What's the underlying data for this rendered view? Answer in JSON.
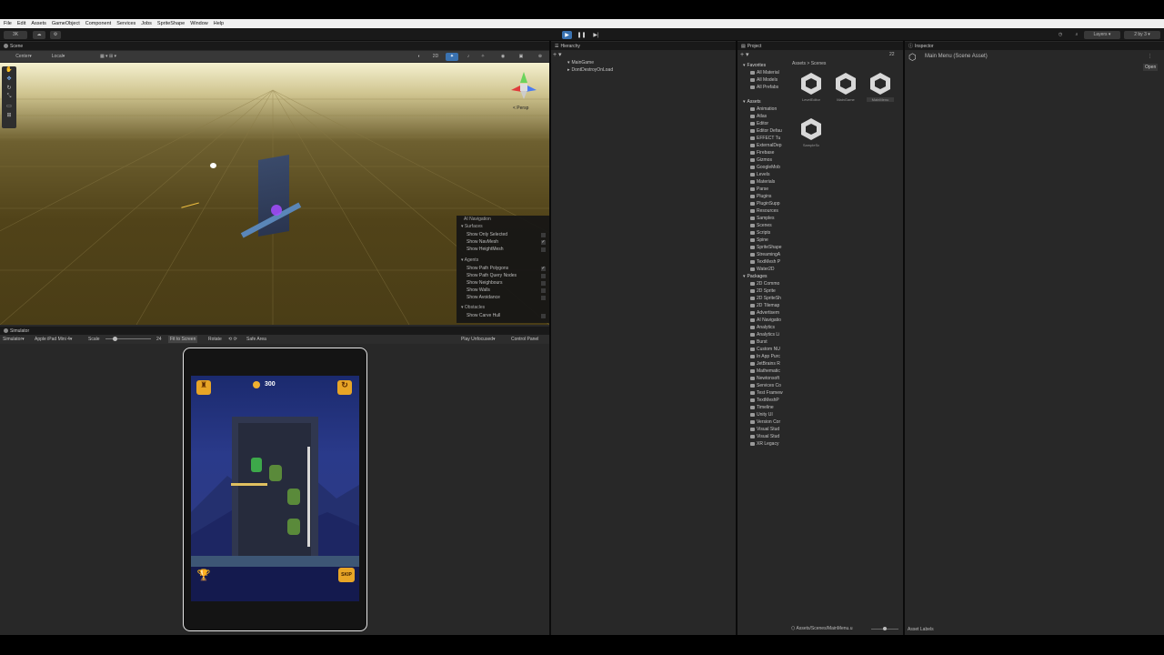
{
  "menu": [
    "File",
    "Edit",
    "Assets",
    "GameObject",
    "Component",
    "Services",
    "Jobs",
    "SpriteShape",
    "Window",
    "Help"
  ],
  "toolbar": {
    "left_label": "3K",
    "layers": "Layers",
    "layout": "2 by 3"
  },
  "scene": {
    "tab": "Scene",
    "pivot": "Center",
    "space": "Local",
    "mode_2d": "2D",
    "persp": "< Persp"
  },
  "ainav": {
    "title": "AI Navigation",
    "surfaces": "Surfaces",
    "surface_items": [
      {
        "label": "Show Only Selected",
        "checked": false
      },
      {
        "label": "Show NavMesh",
        "checked": true
      },
      {
        "label": "Show HeightMesh",
        "checked": false
      }
    ],
    "agents": "Agents",
    "agent_items": [
      {
        "label": "Show Path Polygons",
        "checked": true
      },
      {
        "label": "Show Path Query Nodes",
        "checked": false
      },
      {
        "label": "Show Neighbours",
        "checked": false
      },
      {
        "label": "Show Walls",
        "checked": false
      },
      {
        "label": "Show Avoidance",
        "checked": false
      }
    ],
    "obstacles": "Obstacles",
    "obstacle_items": [
      {
        "label": "Show Carve Hull",
        "checked": false
      }
    ]
  },
  "simulator": {
    "tab": "Simulator",
    "mode": "Simulator",
    "device": "Apple iPad Mini 4",
    "scale_label": "Scale",
    "scale_value": "24",
    "fit": "Fit to Screen",
    "rotate": "Rotate",
    "safe_area": "Safe Area",
    "play_mode": "Play Unfocused",
    "control_panel": "Control Panel"
  },
  "game": {
    "coins": "300",
    "skip": "SKIP"
  },
  "hierarchy": {
    "tab": "Hierarchy",
    "items": [
      "MainGame",
      "DontDestroyOnLoad"
    ]
  },
  "project": {
    "tab": "Project",
    "breadcrumb": [
      "Assets",
      "Scenes"
    ],
    "favorites_label": "Favorites",
    "favorites": [
      "All Material",
      "All Models",
      "All Prefabs"
    ],
    "assets_label": "Assets",
    "assets": [
      "Animation",
      "Atlas",
      "Editor",
      "Editor Defau",
      "EFFECT Tu",
      "ExternalDep",
      "Firebase",
      "Gizmos",
      "GoogleMob",
      "Levels",
      "Materials",
      "Parse",
      "Plugins",
      "PluginSupp",
      "Resources",
      "Samples",
      "Scenes",
      "Scripts",
      "Spine",
      "SpriteShape",
      "StreamingA",
      "TextMesh P",
      "Water2D"
    ],
    "packages_label": "Packages",
    "packages": [
      "2D Commo",
      "2D Sprite",
      "2D SpriteSh",
      "2D Tilemap",
      "Advertisem",
      "AI Navigatio",
      "Analytics",
      "Analytics Li",
      "Burst",
      "Custom NU",
      "In App Purc",
      "JetBrains R",
      "Mathematic",
      "Newtonsoft",
      "Services Co",
      "Test Framew",
      "TextMeshP",
      "Timeline",
      "Unity UI",
      "Version Cor",
      "Visual Stud",
      "Visual Stud",
      "XR Legacy"
    ],
    "scene_files": [
      "LevelEditor",
      "MainGame",
      "MainMenu",
      "SampleSc"
    ],
    "footer_path": "Assets/Scenes/MainMenu.u",
    "count": "22"
  },
  "inspector": {
    "tab": "Inspector",
    "title": "Main Menu (Scene Asset)",
    "open": "Open",
    "asset_labels": "Asset Labels"
  },
  "colors": {
    "panel": "#282828",
    "dark": "#191919",
    "accent": "#3a72b0",
    "game_bg": "#2a3a8a"
  }
}
